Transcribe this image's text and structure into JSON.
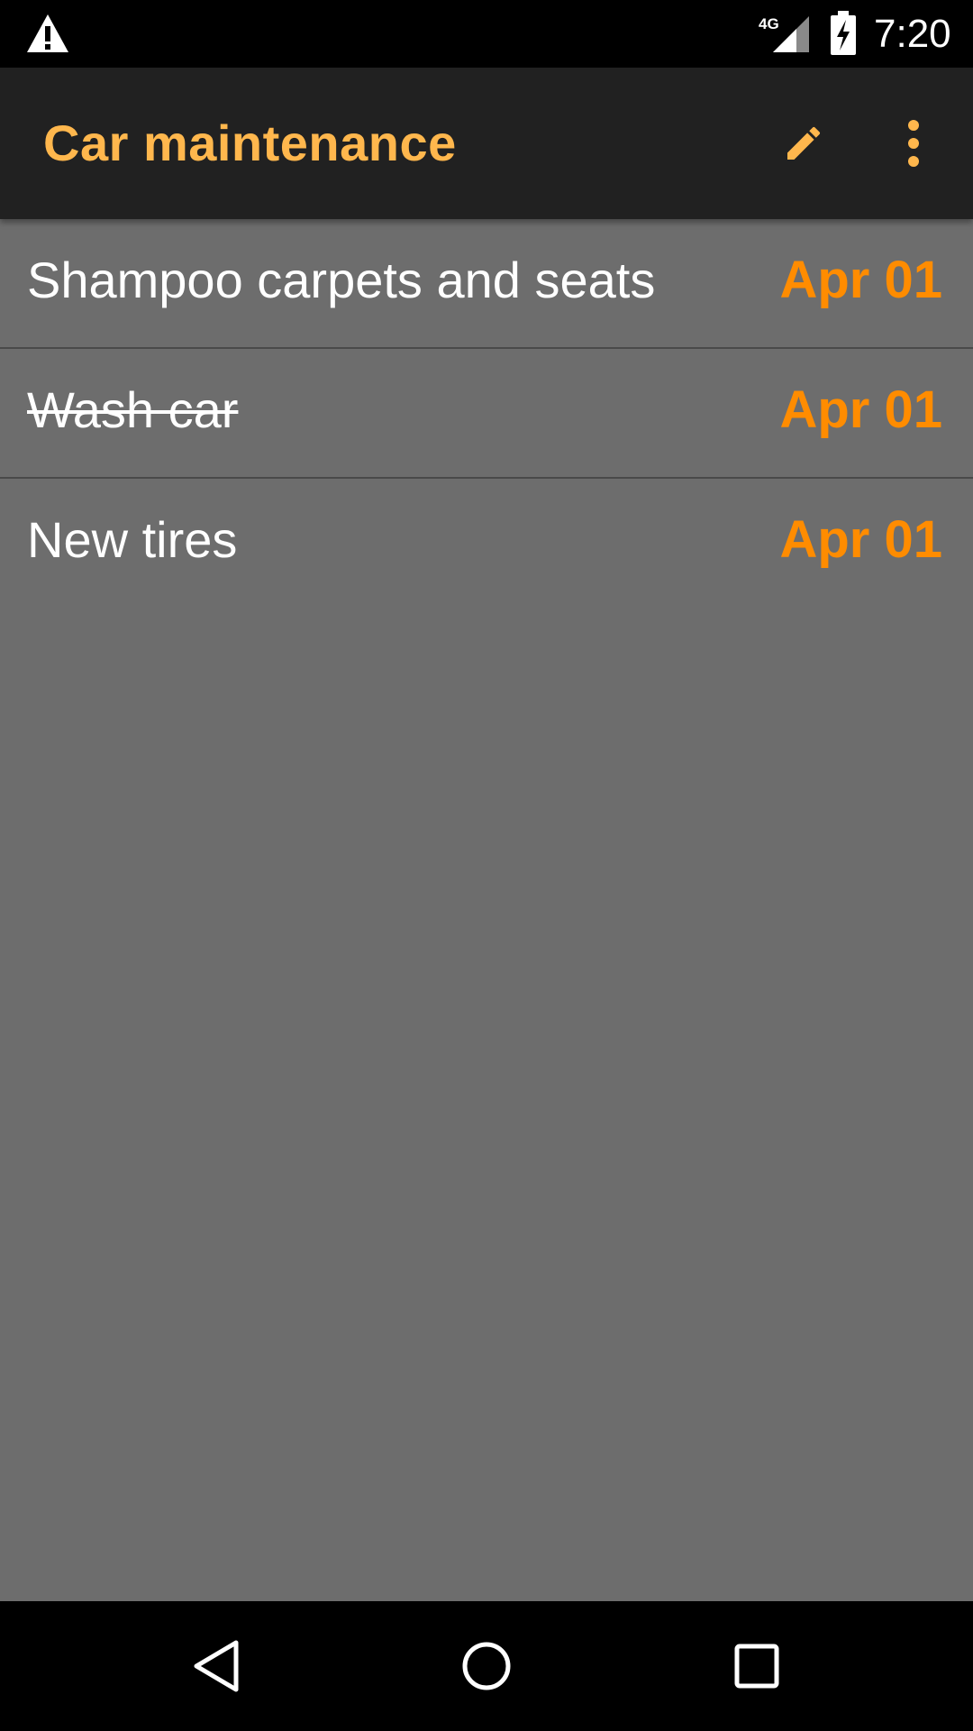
{
  "status_bar": {
    "time": "7:20",
    "network": "4G",
    "icons": [
      "warning-icon",
      "signal-4g-icon",
      "battery-charging-icon"
    ]
  },
  "app_bar": {
    "title": "Car maintenance",
    "actions": [
      "edit-icon",
      "overflow-menu-icon"
    ]
  },
  "tasks": [
    {
      "title": "Shampoo carpets and seats",
      "date": "Apr 01",
      "completed": false
    },
    {
      "title": "Wash car",
      "date": "Apr 01",
      "completed": true
    },
    {
      "title": "New tires",
      "date": "Apr 01",
      "completed": false
    }
  ],
  "nav_bar": {
    "buttons": [
      "back-icon",
      "home-icon",
      "recents-icon"
    ]
  },
  "colors": {
    "accent": "#ffb74d",
    "date": "#ff8c00",
    "background": "#6d6d6d",
    "app_bar": "#212121",
    "divider": "#4a4a4a"
  }
}
